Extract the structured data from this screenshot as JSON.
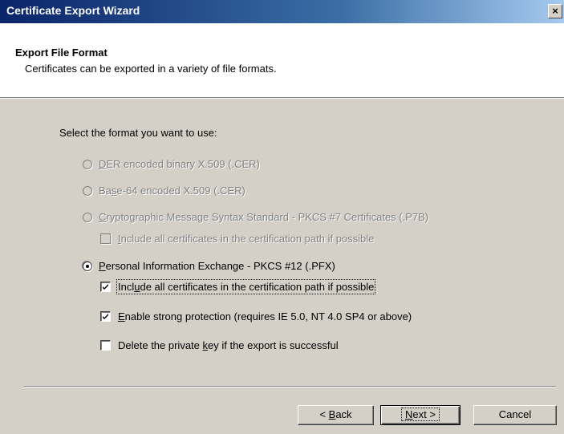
{
  "window": {
    "title": "Certificate Export Wizard",
    "close_symbol": "×"
  },
  "header": {
    "title": "Export File Format",
    "subtitle": "Certificates can be exported in a variety of file formats."
  },
  "prompt": "Select the format you want to use:",
  "options": {
    "der": {
      "pre": "",
      "acc": "D",
      "post": "ER encoded binary X.509 (.CER)",
      "selected": false,
      "enabled": false
    },
    "base64": {
      "pre": "Ba",
      "acc": "s",
      "post": "e-64 encoded X.509 (.CER)",
      "selected": false,
      "enabled": false
    },
    "pkcs7": {
      "pre": "",
      "acc": "C",
      "post": "ryptographic Message Syntax Standard - PKCS #7 Certificates (.P7B)",
      "selected": false,
      "enabled": false
    },
    "pkcs7_include": {
      "pre": "",
      "acc": "I",
      "post": "nclude all certificates in the certification path if possible",
      "checked": false,
      "enabled": false
    },
    "pfx": {
      "pre": "",
      "acc": "P",
      "post": "ersonal Information Exchange - PKCS #12 (.PFX)",
      "selected": true,
      "enabled": true
    },
    "pfx_include": {
      "pre": "Incl",
      "acc": "u",
      "post": "de all certificates in the certification path if possible",
      "checked": true,
      "enabled": true
    },
    "strong": {
      "pre": "",
      "acc": "E",
      "post": "nable strong protection (requires IE 5.0, NT 4.0 SP4 or above)",
      "checked": true,
      "enabled": true
    },
    "delete_key": {
      "pre": "Delete the private ",
      "acc": "k",
      "post": "ey if the export is successful",
      "checked": false,
      "enabled": true
    }
  },
  "buttons": {
    "back": {
      "pre": "< ",
      "acc": "B",
      "post": "ack"
    },
    "next": {
      "pre": "",
      "acc": "N",
      "post": "ext >"
    },
    "cancel": {
      "label": "Cancel"
    }
  }
}
